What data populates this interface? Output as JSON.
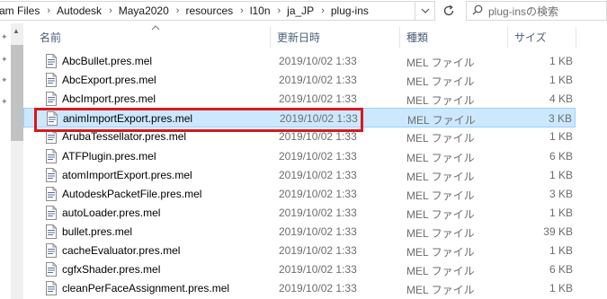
{
  "breadcrumb": [
    "am Files",
    "Autodesk",
    "Maya2020",
    "resources",
    "l10n",
    "ja_JP",
    "plug-ins"
  ],
  "search": {
    "placeholder": "plug-insの検索"
  },
  "columns": {
    "name": "名前",
    "modified": "更新日時",
    "type": "種類",
    "size": "サイズ"
  },
  "files": [
    {
      "name": "AbcBullet.pres.mel",
      "date": "2019/10/02 1:33",
      "type": "MEL ファイル",
      "size": "1 KB"
    },
    {
      "name": "AbcExport.pres.mel",
      "date": "2019/10/02 1:33",
      "type": "MEL ファイル",
      "size": "1 KB"
    },
    {
      "name": "AbcImport.pres.mel",
      "date": "2019/10/02 1:33",
      "type": "MEL ファイル",
      "size": "4 KB"
    },
    {
      "name": "animImportExport.pres.mel",
      "date": "2019/10/02 1:33",
      "type": "MEL ファイル",
      "size": "3 KB",
      "selected": true
    },
    {
      "name": "ArubaTessellator.pres.mel",
      "date": "2019/10/02 1:33",
      "type": "MEL ファイル",
      "size": "1 KB"
    },
    {
      "name": "ATFPlugin.pres.mel",
      "date": "2019/10/02 1:33",
      "type": "MEL ファイル",
      "size": "6 KB"
    },
    {
      "name": "atomImportExport.pres.mel",
      "date": "2019/10/02 1:33",
      "type": "MEL ファイル",
      "size": "1 KB"
    },
    {
      "name": "AutodeskPacketFile.pres.mel",
      "date": "2019/10/02 1:33",
      "type": "MEL ファイル",
      "size": "3 KB"
    },
    {
      "name": "autoLoader.pres.mel",
      "date": "2019/10/02 1:33",
      "type": "MEL ファイル",
      "size": "1 KB"
    },
    {
      "name": "bullet.pres.mel",
      "date": "2019/10/02 1:33",
      "type": "MEL ファイル",
      "size": "39 KB"
    },
    {
      "name": "cacheEvaluator.pres.mel",
      "date": "2019/10/02 1:33",
      "type": "MEL ファイル",
      "size": "1 KB"
    },
    {
      "name": "cgfxShader.pres.mel",
      "date": "2019/10/02 1:33",
      "type": "MEL ファイル",
      "size": "6 KB"
    },
    {
      "name": "cleanPerFaceAssignment.pres.mel",
      "date": "2019/10/02 1:33",
      "type": "MEL ファイル",
      "size": "1 KB"
    }
  ],
  "colors": {
    "selection_bg": "#cce8ff",
    "selection_border": "#99d1ff",
    "annotation": "#d71920",
    "header_text": "#4c607a"
  },
  "icons": {
    "file": "mel-file-icon",
    "search": "search-icon",
    "refresh": "refresh-icon",
    "dropdown": "chevron-down-icon",
    "pin": "pin-icon"
  }
}
